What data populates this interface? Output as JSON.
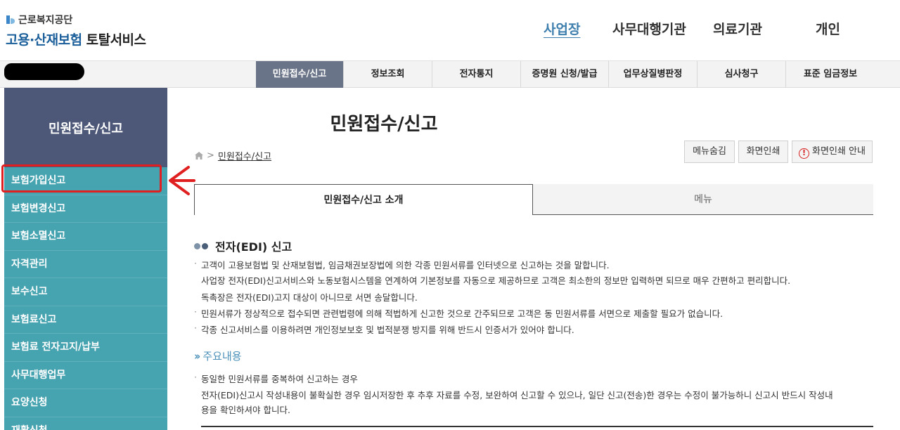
{
  "header": {
    "org_name": "근로복지공단",
    "service_name": "고용·산재보험",
    "service_sub": "토탈서비스",
    "nav": [
      "사업장",
      "사무대행기관",
      "의료기관",
      "개인"
    ]
  },
  "subnav": [
    "민원접수/신고",
    "정보조회",
    "전자통지",
    "증명원 신청/발급",
    "업무상질병판정",
    "심사청구",
    "표준 임금정보"
  ],
  "sidebar": {
    "title": "민원접수/신고",
    "items": [
      "보험가입신고",
      "보험변경신고",
      "보험소멸신고",
      "자격관리",
      "보수신고",
      "보험료신고",
      "보험료 전자고지/납부",
      "사무대행업무",
      "요양신청",
      "재활신청"
    ]
  },
  "main": {
    "title": "민원접수/신고",
    "breadcrumb_sep": ">",
    "breadcrumb": "민원접수/신고",
    "buttons": [
      "메뉴숨김",
      "화면인쇄",
      "화면인쇄 안내"
    ],
    "tabs": [
      "민원접수/신고 소개",
      "메뉴"
    ],
    "section_title": "전자(EDI) 신고",
    "paragraphs": [
      "고객이 고용보험법 및 산재보험법, 임금채권보장법에 의한 각종 민원서류를 인터넷으로 신고하는 것을 말합니다.",
      "사업장 전자(EDI)신고서비스와 노동보험시스템을 연계하여 기본정보를 자동으로 제공하므로 고객은 최소한의 정보만 입력하면 되므로 매우 간편하고 편리합니다.",
      "독촉장은 전자(EDI)고지 대상이 아니므로 서면 송달합니다.",
      "민원서류가 정상적으로 접수되면 관련법령에 의해 적법하게 신고한 것으로 간주되므로 고객은 동 민원서류를 서면으로 제출할 필요가 없습니다.",
      "각종 신고서비스를 이용하려면 개인정보보호 및 법적분쟁 방지를 위해 반드시 인증서가 있어야 합니다."
    ],
    "sub_title": "주요내용",
    "sub_paragraphs": [
      "동일한 민원서류를 중복하여 신고하는 경우",
      "전자(EDI)신고시 작성내용이 불확실한 경우 임시저장한 후 추후 자료를 수정, 보완하여 신고할 수 있으나, 일단 신고(전송)한 경우는 수정이 불가능하니 신고시 반드시 작성내",
      "용을 확인하셔야 합니다."
    ]
  },
  "colors": {
    "sidebar_bg": "#46a3b0",
    "sidebar_head": "#4d5878",
    "subnav_active": "#6a7488",
    "brand_blue": "#1b5f9a",
    "annotation_red": "#e02020"
  }
}
